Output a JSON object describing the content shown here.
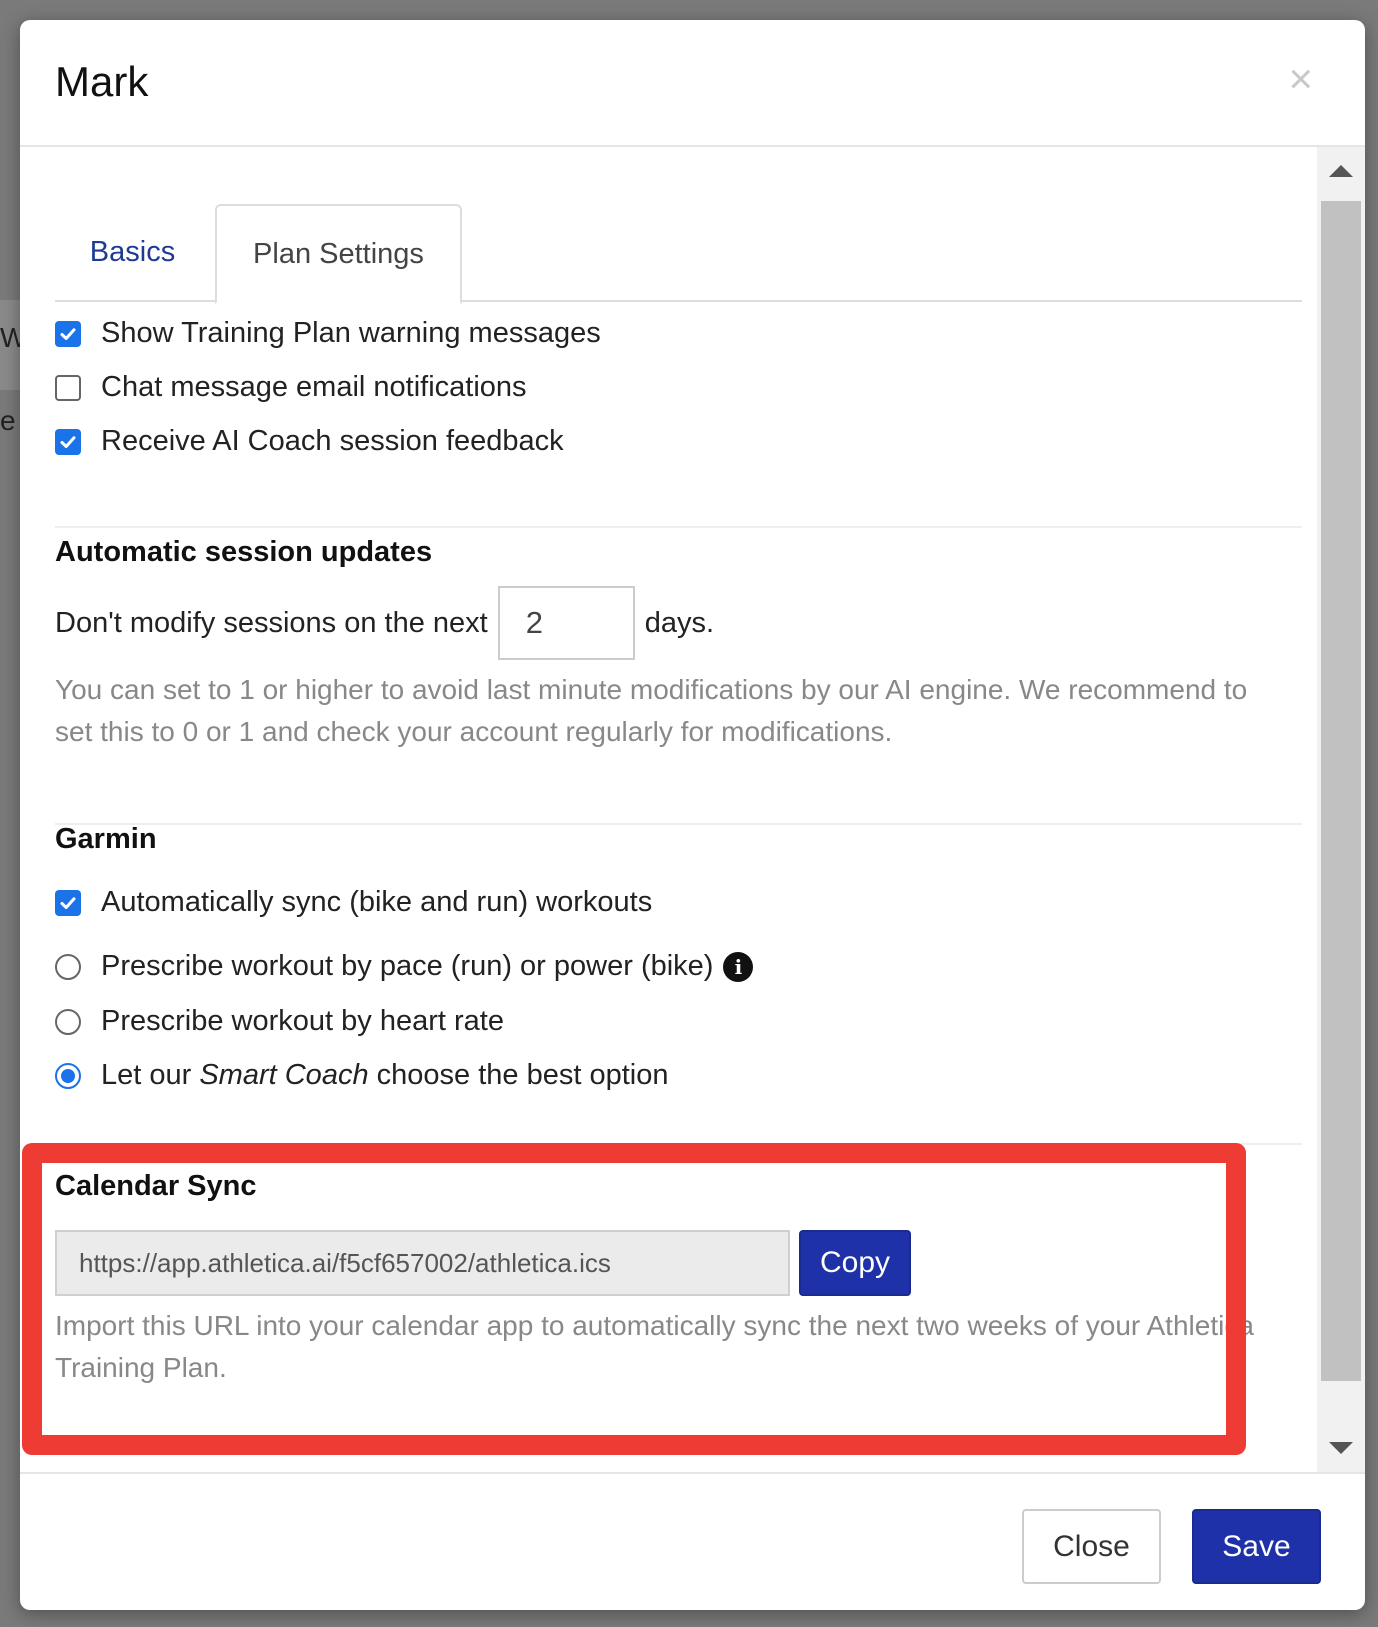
{
  "background": {
    "letters": [
      "W",
      "e"
    ]
  },
  "modal": {
    "title": "Mark",
    "close_symbol": "×"
  },
  "tabs": [
    {
      "label": "Basics",
      "active": false
    },
    {
      "label": "Plan Settings",
      "active": true
    }
  ],
  "checkboxes": [
    {
      "label": "Show Training Plan warning messages",
      "checked": true
    },
    {
      "label": "Chat message email notifications",
      "checked": false
    },
    {
      "label": "Receive AI Coach session feedback",
      "checked": true
    }
  ],
  "auto_updates": {
    "title": "Automatic session updates",
    "prefix": "Don't modify sessions on the next",
    "value": "2",
    "suffix": "days.",
    "help": "You can set to 1 or higher to avoid last minute modifications by our AI engine. We recommend to set this to 0 or 1 and check your account regularly for modifications."
  },
  "garmin": {
    "title": "Garmin",
    "sync_label": "Automatically sync (bike and run) workouts",
    "sync_checked": true,
    "options": [
      {
        "label": "Prescribe workout by pace (run) or power (bike)",
        "selected": false
      },
      {
        "label": "Prescribe workout by heart rate",
        "selected": false
      },
      {
        "label_pre": "Let our ",
        "label_em": "Smart Coach",
        "label_post": " choose the best option",
        "selected": true
      }
    ]
  },
  "calendar_sync": {
    "title": "Calendar Sync",
    "url": "https://app.athletica.ai/f5cf657002/athletica.ics",
    "copy_label": "Copy",
    "help": "Import this URL into your calendar app to automatically sync the next two weeks of your Athletica Training Plan."
  },
  "footer": {
    "close_label": "Close",
    "save_label": "Save"
  },
  "colors": {
    "accent": "#1f31a8",
    "checkbox": "#1a73e8",
    "highlight": "#ee3c34"
  }
}
